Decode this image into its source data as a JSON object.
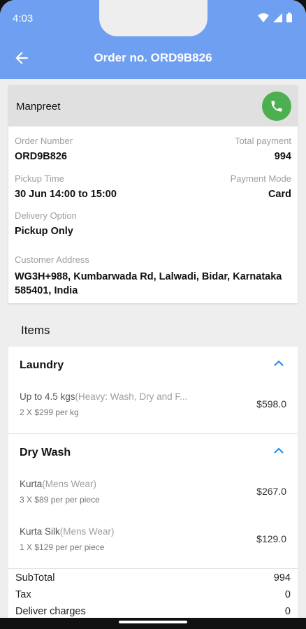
{
  "status": {
    "time": "4:03"
  },
  "header": {
    "title": "Order no. ORD9B826"
  },
  "customer": {
    "name": "Manpreet",
    "order_number_label": "Order Number",
    "order_number": "ORD9B826",
    "total_payment_label": "Total payment",
    "total_payment": "994",
    "pickup_time_label": "Pickup Time",
    "pickup_time": "30 Jun 14:00 to 15:00",
    "payment_mode_label": "Payment Mode",
    "payment_mode": "Card",
    "delivery_option_label": "Delivery Option",
    "delivery_option": "Pickup Only",
    "address_label": "Customer Address",
    "address": "WG3H+988, Kumbarwada Rd, Lalwadi, Bidar, Karnataka 585401, India"
  },
  "items": {
    "title": "Items",
    "groups": [
      {
        "title": "Laundry",
        "rows": [
          {
            "name": "Up to 4.5 kgs",
            "sub": "(Heavy: Wash, Dry and F...",
            "qty": "2 X $299 per kg",
            "price": "$598.0"
          }
        ]
      },
      {
        "title": "Dry Wash",
        "rows": [
          {
            "name": "Kurta",
            "sub": "(Mens Wear)",
            "qty": "3 X $89 per per piece",
            "price": "$267.0"
          },
          {
            "name": "Kurta Silk",
            "sub": "(Mens Wear)",
            "qty": "1 X $129 per per piece",
            "price": "$129.0"
          }
        ]
      }
    ]
  },
  "totals": {
    "subtotal_label": "SubTotal",
    "subtotal": "994",
    "tax_label": "Tax",
    "tax": "0",
    "delivery_label": "Deliver charges",
    "delivery": "0"
  },
  "colors": {
    "appbar": "#6f9ff0",
    "call": "#4caf50",
    "accent": "#1e88e5"
  }
}
